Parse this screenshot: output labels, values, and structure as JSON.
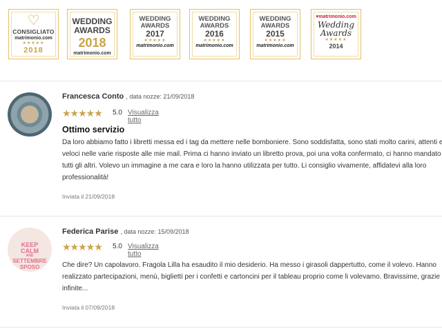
{
  "badges": {
    "b1": {
      "line1": "CONSIGLIATO",
      "line2": "matrimonio.com",
      "stars": "★★★★★",
      "year": "2018"
    },
    "b2": {
      "line1": "WEDDING",
      "line2": "AWARDS",
      "year": "2018",
      "site": "matrimonio.com"
    },
    "b3": {
      "line1": "WEDDING",
      "line2": "AWARDS",
      "year": "2017",
      "stars": "★★★★★",
      "site": "matrimonio.com"
    },
    "b4": {
      "line1": "WEDDING",
      "line2": "AWARDS",
      "year": "2016",
      "stars": "★★★★★",
      "site": "matrimonio.com"
    },
    "b5": {
      "line1": "WEDDING",
      "line2": "AWARDS",
      "year": "2015",
      "stars": "★★★★★",
      "site": "matrimonio.com"
    },
    "b6": {
      "site": "matrimonio.com",
      "line1": "Wedding",
      "line2": "Awards",
      "stars": "★★★★★",
      "year": "2014"
    }
  },
  "reviews": [
    {
      "name": "Francesca Conto",
      "date_label": ", data nozze: 21/09/2018",
      "stars": "★★★★★",
      "score": "5.0",
      "link": "Visualizza tutto",
      "title": "Ottimo servizio",
      "body": "Da loro abbiamo fatto i libretti messa ed i tag da mettere nelle bomboniere. Sono soddisfatta, sono stati molto carini, attenti e veloci nelle varie risposte alle mie mail. Prima ci hanno inviato un libretto prova, poi una volta confermato, ci hanno mandato tutti gli altri. Volevo un immagine a me cara e loro la hanno utilizzata per tutto. Li consiglio vivamente, affidatevi alla loro professionalità!",
      "sent": "Inviata il 21/09/2018"
    },
    {
      "name": "Federica Parise",
      "date_label": ", data nozze: 15/09/2018",
      "stars": "★★★★★",
      "score": "5.0",
      "link": "Visualizza tutto",
      "body": "Che dire? Un capolavoro. Fragola Lilla ha esaudito il mio desiderio. Ha messo i girasoli dappertutto, come il volevo. Hanno realizzato partecipazioni, menù, biglietti per i confetti e cartoncini per il tableau proprio come li volevamo. Bravissime, grazie infinite...",
      "sent": "Inviata il 07/09/2018",
      "avatar_text": [
        "KEEP",
        "CALM",
        "AND",
        "SETTEMBRE",
        "SPOSO"
      ]
    }
  ],
  "colors": {
    "gold": "#c9a347",
    "red": "#c8203a"
  },
  "icons": {
    "heart": "heart-icon",
    "star": "star-icon"
  }
}
